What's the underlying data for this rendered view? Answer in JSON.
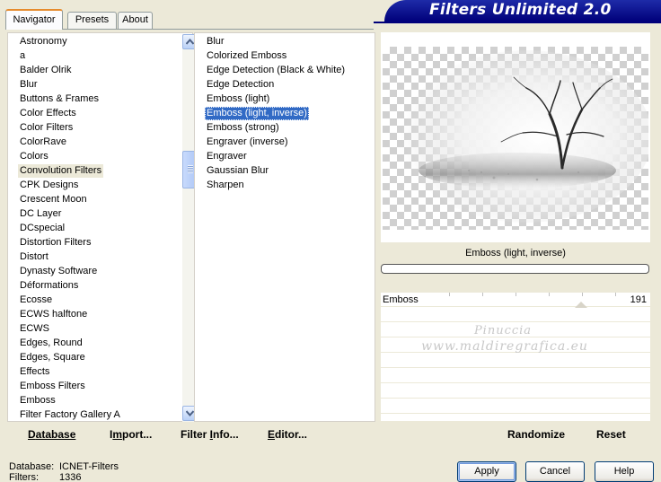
{
  "app": {
    "title": "Filters Unlimited 2.0"
  },
  "tabs": [
    {
      "label": "Navigator",
      "active": true
    },
    {
      "label": "Presets",
      "active": false
    },
    {
      "label": "About",
      "active": false
    }
  ],
  "categories": {
    "selected": "Convolution Filters",
    "items": [
      "Astronomy",
      "a",
      "Balder Olrik",
      "Blur",
      "Buttons & Frames",
      "Color Effects",
      "Color Filters",
      "ColorRave",
      "Colors",
      "Convolution Filters",
      "CPK Designs",
      "Crescent Moon",
      "DC Layer",
      "DCspecial",
      "Distortion Filters",
      "Distort",
      "Dynasty Software",
      "Déformations",
      "Ecosse",
      "ECWS halftone",
      "ECWS",
      "Edges, Round",
      "Edges, Square",
      "Effects",
      "Emboss Filters",
      "Emboss",
      "Filter Factory Gallery A"
    ]
  },
  "filters": {
    "selected": "Emboss (light, inverse)",
    "items": [
      "Blur",
      "Colorized Emboss",
      "Edge Detection (Black & White)",
      "Edge Detection",
      "Emboss (light)",
      "Emboss (light, inverse)",
      "Emboss (strong)",
      "Engraver (inverse)",
      "Engraver",
      "Gaussian Blur",
      "Sharpen"
    ]
  },
  "preview": {
    "filter_name": "Emboss (light, inverse)",
    "progress": 0
  },
  "params": [
    {
      "label": "Emboss",
      "value": "191"
    }
  ],
  "watermark": {
    "line1": "Pinuccia",
    "line2": "www.maldiregrafica.eu"
  },
  "toolbar": {
    "database": {
      "u": "D",
      "rest": "atabase"
    },
    "import": {
      "pre": "I",
      "u": "m",
      "rest": "port..."
    },
    "filter_info": {
      "pre": "Filter ",
      "u": "I",
      "rest": "nfo..."
    },
    "editor": {
      "u": "E",
      "rest": "ditor..."
    },
    "randomize": "Randomize",
    "reset": "Reset"
  },
  "status": {
    "database_label": "Database:",
    "database_value": "ICNET-Filters",
    "filters_label": "Filters:",
    "filters_value": "1336"
  },
  "buttons": {
    "apply": "Apply",
    "cancel": "Cancel",
    "help": "Help"
  },
  "colors": {
    "banner": "#00007a",
    "selection": "#316ac5",
    "background": "#ece9d8"
  },
  "icons": {
    "scroll_up": "chevron-up-icon",
    "scroll_down": "chevron-down-icon"
  }
}
